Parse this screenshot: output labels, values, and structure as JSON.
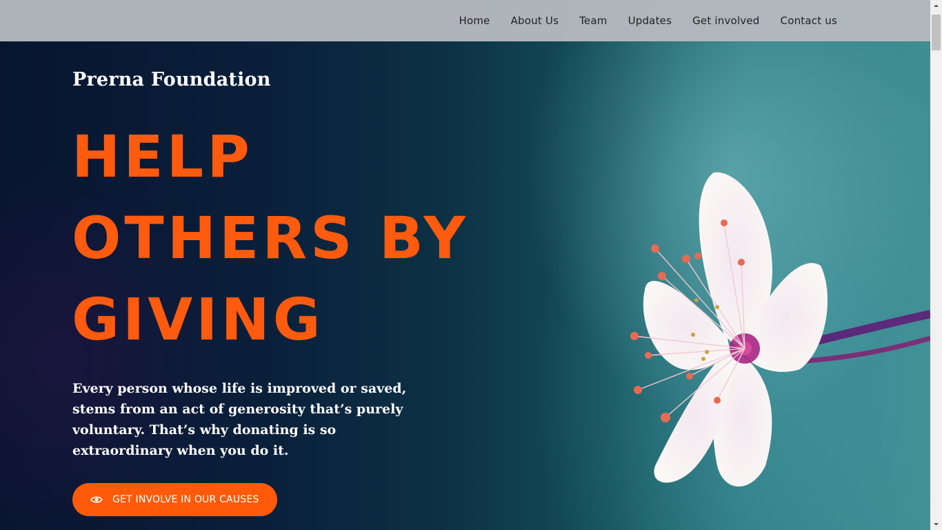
{
  "nav": {
    "items": [
      {
        "label": "Home"
      },
      {
        "label": "About Us"
      },
      {
        "label": "Team"
      },
      {
        "label": "Updates"
      },
      {
        "label": "Get involved"
      },
      {
        "label": "Contact us"
      }
    ]
  },
  "hero": {
    "brand": "Prerna Foundation",
    "headline_lines": [
      "HELP",
      "OTHERS BY",
      "GIVING"
    ],
    "tagline": "Every person whose life is improved or saved, stems from an act of generosity that’s purely voluntary. That’s why donating is so extraordinary when you do it.",
    "cta_label": "GET INVOLVE IN OUR CAUSES",
    "cta_icon": "eye-icon",
    "image": "cherry-blossom-flower"
  },
  "colors": {
    "accent": "#ff5b0f",
    "nav_bg": "#b4b9be",
    "hero_dark": "#07152f",
    "hero_teal": "#3f8f93"
  }
}
